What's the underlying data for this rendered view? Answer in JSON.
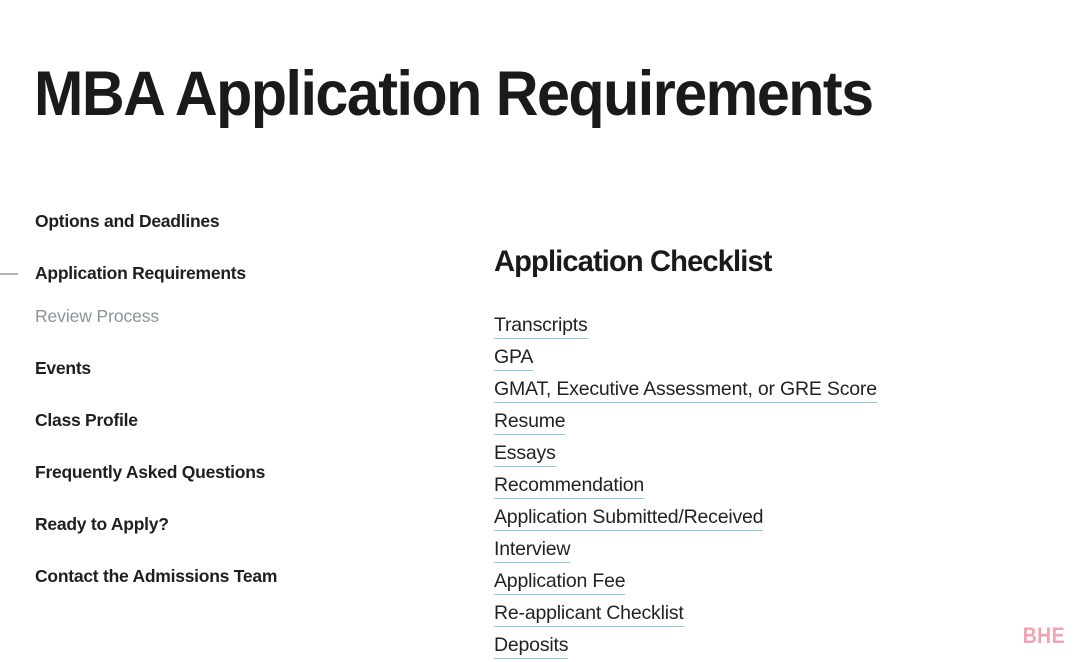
{
  "page": {
    "title": "MBA Application Requirements",
    "background_color": "#ffffff"
  },
  "sidebar": {
    "active_marker_color": "#b3b3b3",
    "items": [
      {
        "label": "Options and Deadlines",
        "level": "main",
        "state": "default"
      },
      {
        "label": "Application Requirements",
        "level": "main",
        "state": "active"
      },
      {
        "label": "Review Process",
        "level": "sub",
        "state": "default"
      },
      {
        "label": "Events",
        "level": "main",
        "state": "default"
      },
      {
        "label": "Class Profile",
        "level": "main",
        "state": "default"
      },
      {
        "label": "Frequently Asked Questions",
        "level": "main",
        "state": "default"
      },
      {
        "label": "Ready to Apply?",
        "level": "main",
        "state": "default"
      },
      {
        "label": "Contact the Admissions Team",
        "level": "main",
        "state": "default"
      }
    ]
  },
  "main": {
    "heading": "Application Checklist",
    "link_underline_color": "#8ec5ea",
    "link_text_color": "#1f2124",
    "checklist": [
      {
        "label": "Transcripts"
      },
      {
        "label": "GPA"
      },
      {
        "label": "GMAT, Executive Assessment, or GRE Score"
      },
      {
        "label": "Resume"
      },
      {
        "label": "Essays"
      },
      {
        "label": "Recommendation"
      },
      {
        "label": "Application Submitted/Received"
      },
      {
        "label": "Interview"
      },
      {
        "label": "Application Fee"
      },
      {
        "label": "Re-applicant Checklist"
      },
      {
        "label": "Deposits"
      }
    ]
  },
  "brand": {
    "mark": "BHE",
    "color": "#f2a3b0"
  }
}
